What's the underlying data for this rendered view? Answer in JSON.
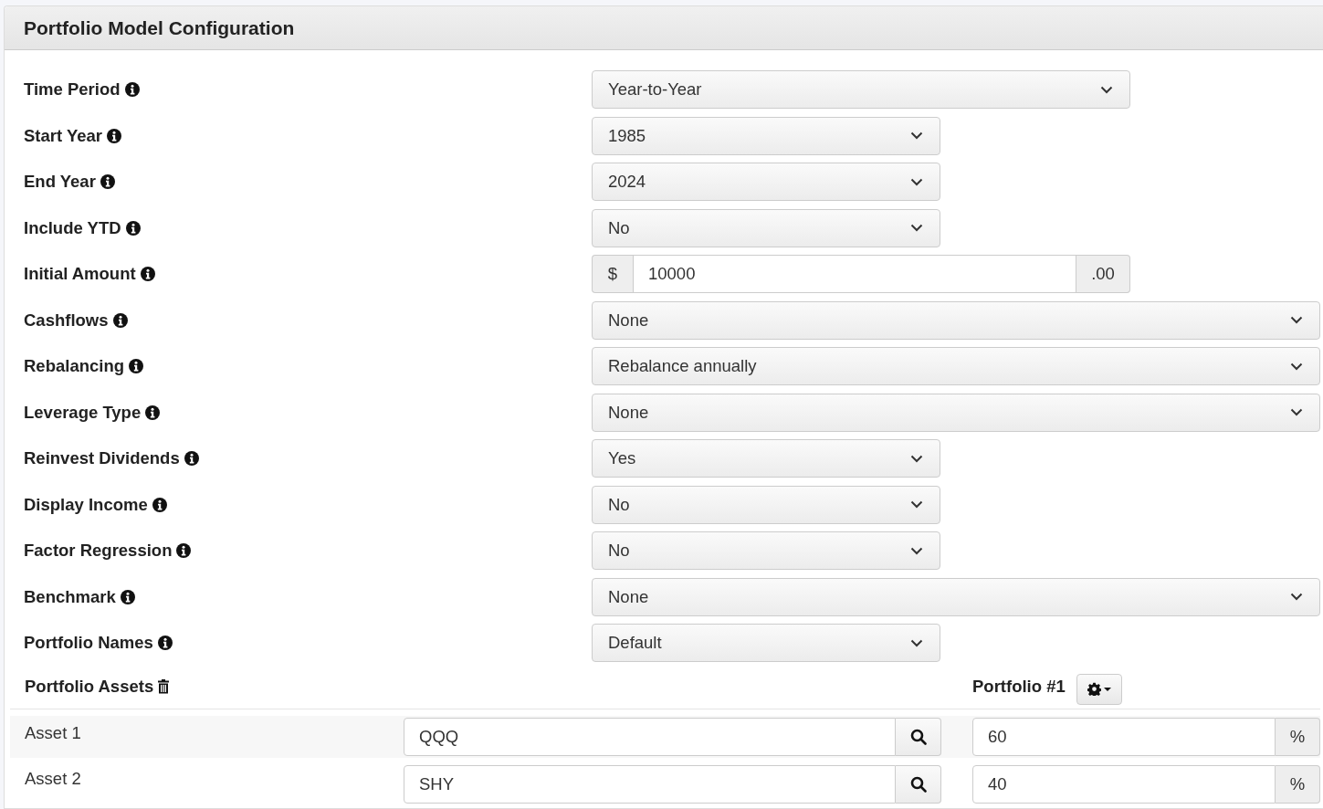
{
  "panel": {
    "title": "Portfolio Model Configuration"
  },
  "settings": [
    {
      "label": "Time Period",
      "kind": "longselect",
      "value": "Year-to-Year"
    },
    {
      "label": "Start Year",
      "kind": "shortselect",
      "value": "1985"
    },
    {
      "label": "End Year",
      "kind": "shortselect",
      "value": "2024"
    },
    {
      "label": "Include YTD",
      "kind": "shortselect",
      "value": "No"
    },
    {
      "label": "Initial Amount",
      "kind": "amount",
      "prefix": "$",
      "value": "10000",
      "suffix": ".00"
    },
    {
      "label": "Cashflows",
      "kind": "fullselect",
      "value": "None"
    },
    {
      "label": "Rebalancing",
      "kind": "fullselect",
      "value": "Rebalance annually"
    },
    {
      "label": "Leverage Type",
      "kind": "fullselect",
      "value": "None"
    },
    {
      "label": "Reinvest Dividends",
      "kind": "shortselect",
      "value": "Yes"
    },
    {
      "label": "Display Income",
      "kind": "shortselect",
      "value": "No"
    },
    {
      "label": "Factor Regression",
      "kind": "shortselect",
      "value": "No"
    },
    {
      "label": "Benchmark",
      "kind": "fullselect",
      "value": "None"
    },
    {
      "label": "Portfolio Names",
      "kind": "shortselect",
      "value": "Default"
    }
  ],
  "assets_header": {
    "label": "Portfolio Assets",
    "portfolio_label": "Portfolio #1"
  },
  "assets": [
    {
      "label": "Asset 1",
      "ticker": "QQQ",
      "weight": "60",
      "unit": "%"
    },
    {
      "label": "Asset 2",
      "ticker": "SHY",
      "weight": "40",
      "unit": "%"
    }
  ]
}
